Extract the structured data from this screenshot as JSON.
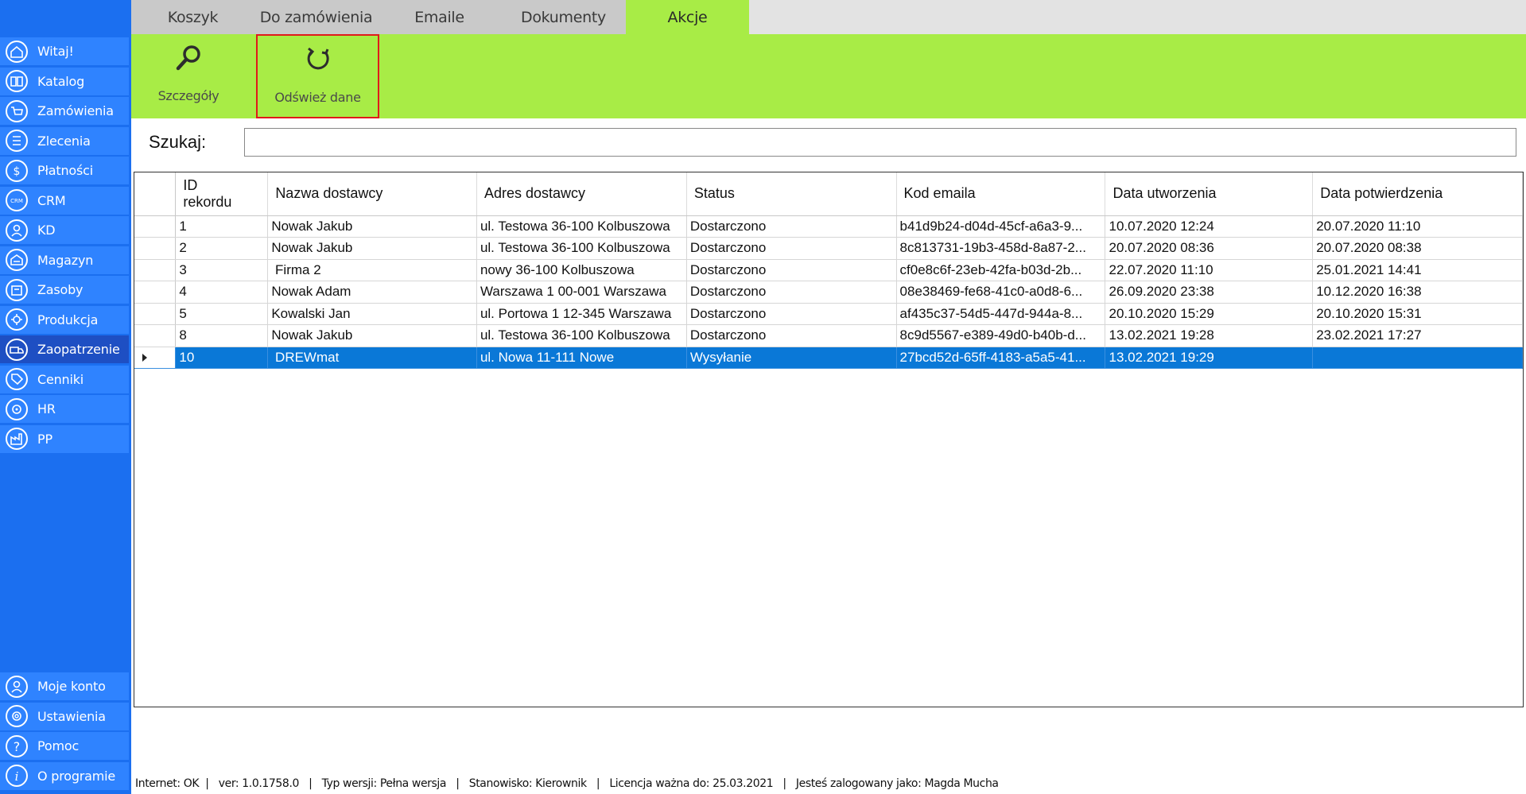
{
  "sidebar": {
    "items": [
      {
        "label": "Witaj!",
        "icon": "home-icon"
      },
      {
        "label": "Katalog",
        "icon": "book-icon"
      },
      {
        "label": "Zamówienia",
        "icon": "cart-icon"
      },
      {
        "label": "Zlecenia",
        "icon": "list-icon"
      },
      {
        "label": "Płatności",
        "icon": "dollar-icon"
      },
      {
        "label": "CRM",
        "icon": "crm-icon"
      },
      {
        "label": "KD",
        "icon": "person-icon"
      },
      {
        "label": "Magazyn",
        "icon": "warehouse-icon"
      },
      {
        "label": "Zasoby",
        "icon": "box-icon"
      },
      {
        "label": "Produkcja",
        "icon": "production-icon"
      },
      {
        "label": "Zaopatrzenie",
        "icon": "truck-icon"
      },
      {
        "label": "Cenniki",
        "icon": "tag-icon"
      },
      {
        "label": "HR",
        "icon": "hr-icon"
      },
      {
        "label": "PP",
        "icon": "factory-icon"
      }
    ],
    "bottom_items": [
      {
        "label": "Moje konto",
        "icon": "account-icon"
      },
      {
        "label": "Ustawienia",
        "icon": "settings-icon"
      },
      {
        "label": "Pomoc",
        "icon": "help-icon"
      },
      {
        "label": "O programie",
        "icon": "info-icon"
      }
    ],
    "active": "Zaopatrzenie"
  },
  "tabs": [
    "Koszyk",
    "Do zamówienia",
    "Emaile",
    "Dokumenty",
    "Akcje"
  ],
  "active_tab": "Akcje",
  "ribbon": {
    "details_label": "Szczegóły",
    "refresh_label": "Odśwież dane"
  },
  "search": {
    "label": "Szukaj:",
    "value": ""
  },
  "grid": {
    "columns": [
      "ID\nrekordu",
      "Nazwa dostawcy",
      "Adres dostawcy",
      "Status",
      "Kod emaila",
      "Data utworzenia",
      "Data potwierdzenia"
    ],
    "rows": [
      [
        "1",
        "Nowak Jakub",
        "ul. Testowa 36-100 Kolbuszowa",
        "Dostarczono",
        "b41d9b24-d04d-45cf-a6a3-9...",
        "10.07.2020 12:24",
        "20.07.2020 11:10"
      ],
      [
        "2",
        "Nowak Jakub",
        "ul. Testowa 36-100 Kolbuszowa",
        "Dostarczono",
        "8c813731-19b3-458d-8a87-2...",
        "20.07.2020 08:36",
        "20.07.2020 08:38"
      ],
      [
        "3",
        " Firma 2",
        "nowy 36-100 Kolbuszowa",
        "Dostarczono",
        "cf0e8c6f-23eb-42fa-b03d-2b...",
        "22.07.2020 11:10",
        "25.01.2021 14:41"
      ],
      [
        "4",
        "Nowak Adam",
        "Warszawa 1 00-001 Warszawa",
        "Dostarczono",
        "08e38469-fe68-41c0-a0d8-6...",
        "26.09.2020 23:38",
        "10.12.2020 16:38"
      ],
      [
        "5",
        "Kowalski Jan",
        "ul. Portowa 1 12-345 Warszawa",
        "Dostarczono",
        "af435c37-54d5-447d-944a-8...",
        "20.10.2020 15:29",
        "20.10.2020 15:31"
      ],
      [
        "8",
        "Nowak Jakub",
        "ul. Testowa 36-100 Kolbuszowa",
        "Dostarczono",
        "8c9d5567-e389-49d0-b40b-d...",
        "13.02.2021 19:28",
        "23.02.2021 17:27"
      ],
      [
        "10",
        " DREWmat",
        "ul. Nowa 11-111 Nowe",
        "Wysyłanie",
        "27bcd52d-65ff-4183-a5a5-41...",
        "13.02.2021 19:29",
        ""
      ]
    ],
    "selected_row": 6
  },
  "statusbar": {
    "text": "Internet: OK  |   ver: 1.0.1758.0   |   Typ wersji: Pełna wersja   |   Stanowisko: Kierownik   |   Licencja ważna do: 25.03.2021   |   Jesteś zalogowany jako: Magda Mucha"
  },
  "colors": {
    "sidebar_bg": "#1b6ff0",
    "sidebar_item": "#2f83ff",
    "ribbon_bg": "#a8ec46",
    "selection": "#0a78d7",
    "highlight_border": "#e01a1a"
  }
}
